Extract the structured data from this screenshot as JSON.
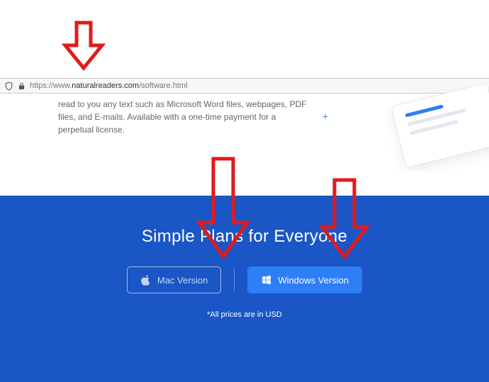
{
  "browser": {
    "url_prefix": "https://www.",
    "url_domain": "naturalreaders.com",
    "url_path": "/software.html"
  },
  "page": {
    "description_text": "read to you any text such as Microsoft Word files, webpages, PDF files, and E-mails. Available with a one-time payment for a perpetual license."
  },
  "pricing": {
    "headline": "Simple Plans for Everyone",
    "mac_label": "Mac Version",
    "windows_label": "Windows Version",
    "footnote": "*All prices are in USD"
  },
  "annotations": {
    "arrow_color": "#e11b1b"
  }
}
